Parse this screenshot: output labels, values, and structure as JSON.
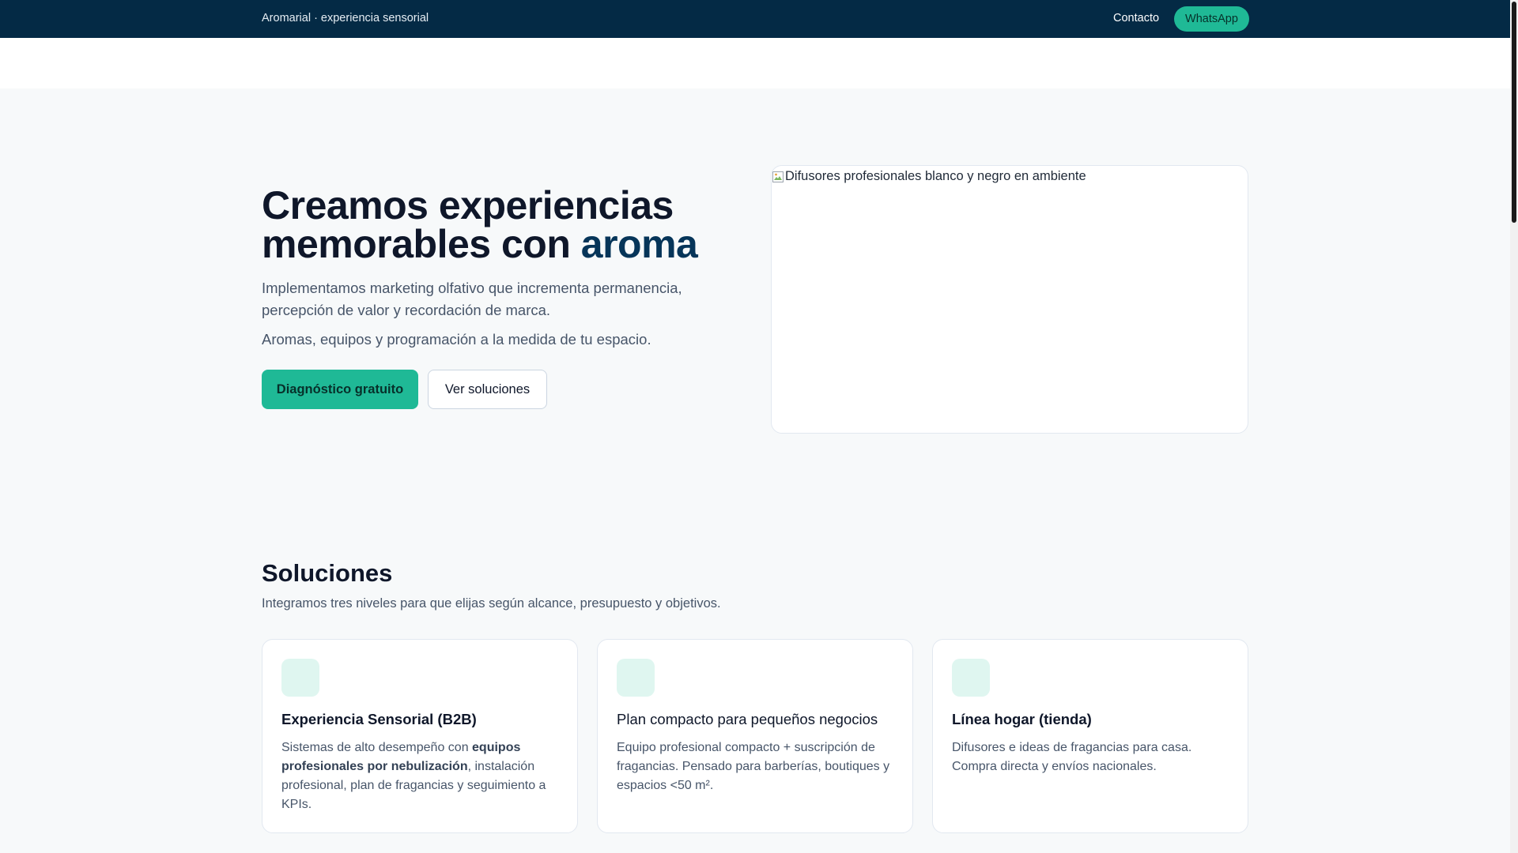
{
  "header": {
    "brand": "Aromarial · experiencia sensorial",
    "contact_label": "Contacto",
    "whatsapp_label": "WhatsApp"
  },
  "hero": {
    "title_part1": "Creamos experiencias memorables con ",
    "title_accent": "aroma",
    "paragraph1": "Implementamos marketing olfativo que incrementa permanencia, percepción de valor y recordación de marca.",
    "paragraph2": "Aromas, equipos y programación a la medida de tu espacio.",
    "primary_button": "Diagnóstico gratuito",
    "secondary_button": "Ver soluciones",
    "image_alt": "Difusores profesionales blanco y negro en ambiente"
  },
  "solutions": {
    "title": "Soluciones",
    "subtitle": "Integramos tres niveles para que elijas según alcance, presupuesto y objetivos.",
    "cards": [
      {
        "title": "Experiencia Sensorial (B2B)",
        "desc_before": "Sistemas de alto desempeño con ",
        "desc_bold": "equipos profesionales por nebulización",
        "desc_after": ", instalación profesional, plan de fragancias y seguimiento a KPIs."
      },
      {
        "title": "Plan compacto para pequeños negocios",
        "desc": "Equipo profesional compacto + suscripción de fragancias. Pensado para barberías, boutiques y espacios <50 m²."
      },
      {
        "title": "Línea hogar (tienda)",
        "desc": "Difusores e ideas de fragancias para casa. Compra directa y envíos nacionales."
      }
    ]
  },
  "colors": {
    "header_bg": "#042a45",
    "accent_green": "#1fb996",
    "accent_navy": "#063559",
    "icon_tile": "#dff6f0"
  },
  "icons": {
    "broken_image": "broken-image-icon"
  }
}
